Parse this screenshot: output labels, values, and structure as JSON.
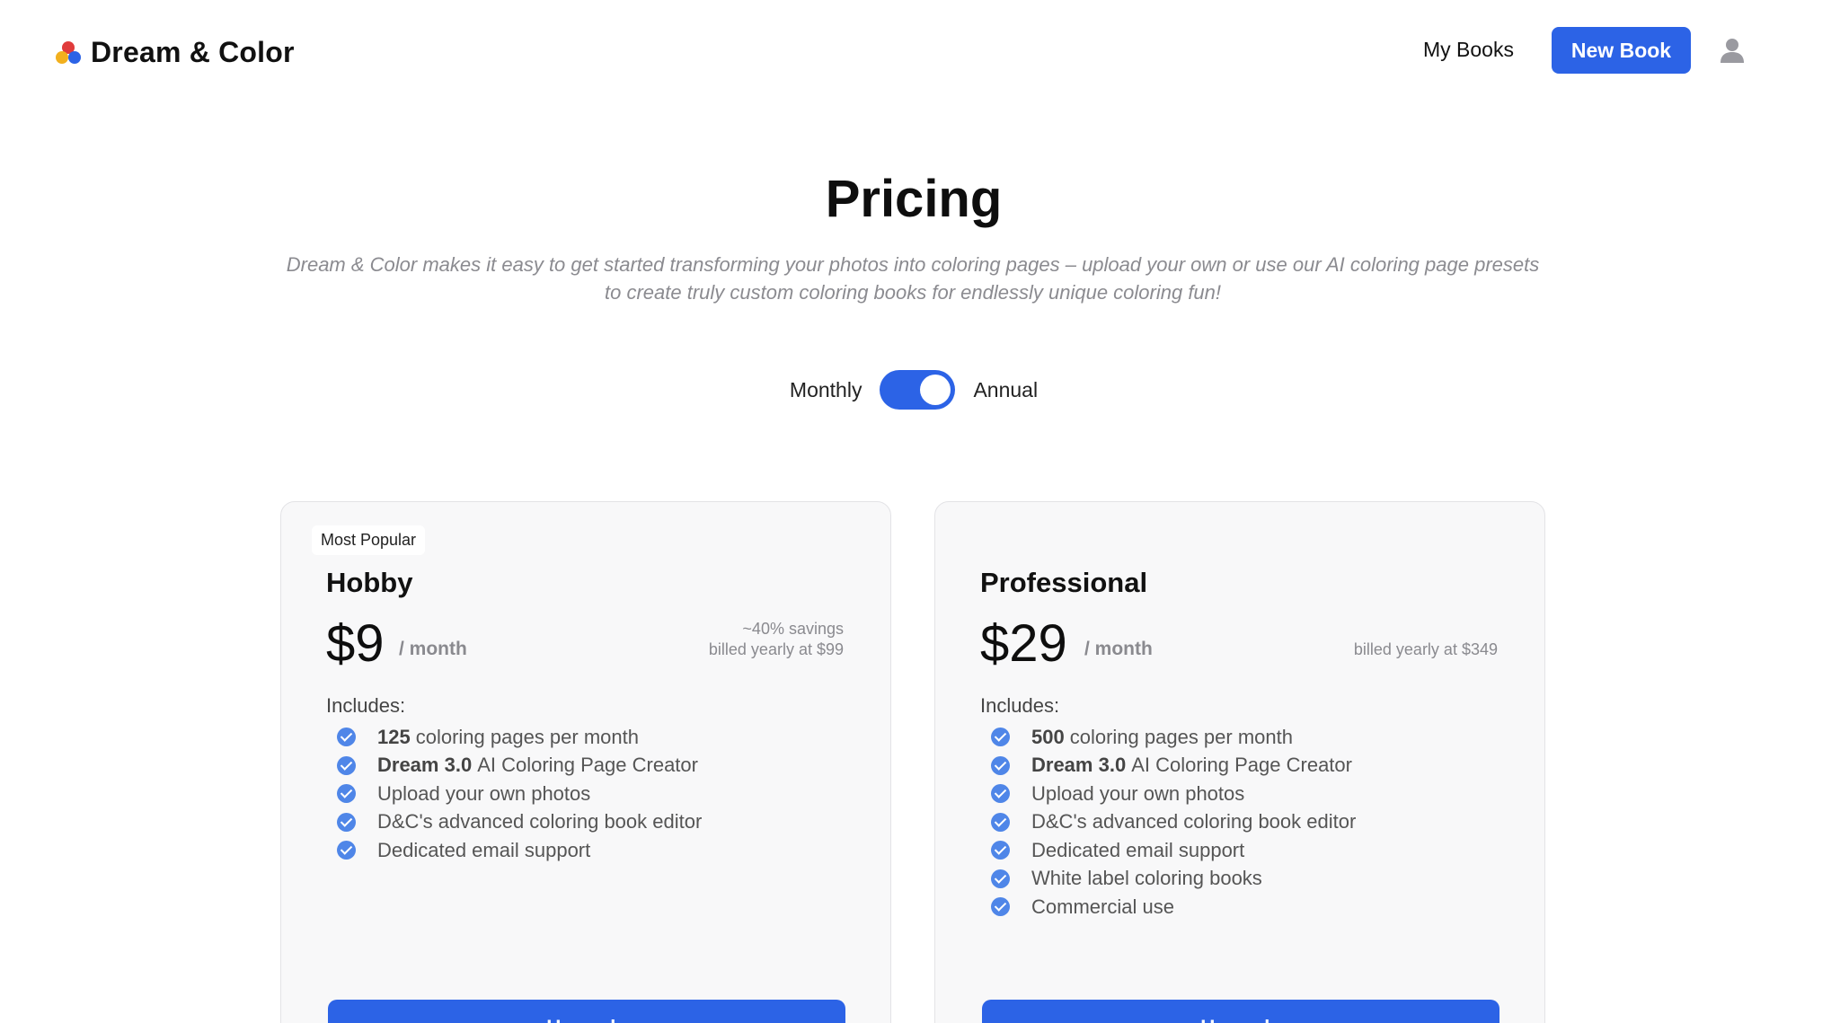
{
  "brand": {
    "name": "Dream & Color",
    "logo_colors": [
      "#e03b3b",
      "#f2b01e",
      "#2c63e6"
    ]
  },
  "nav": {
    "my_books": "My Books",
    "new_book": "New Book",
    "user_icon": "user-icon"
  },
  "page": {
    "title": "Pricing",
    "subtitle": "Dream & Color makes it easy to get started transforming your photos into coloring pages – upload your own or use our AI coloring page presets to create truly custom coloring books for endlessly unique coloring fun!"
  },
  "billing_toggle": {
    "left_label": "Monthly",
    "right_label": "Annual",
    "selected": "Annual"
  },
  "plans": [
    {
      "badge": "Most Popular",
      "name": "Hobby",
      "price": "$9",
      "period": "/ month",
      "savings": "~40% savings",
      "billed": "billed yearly at $99",
      "includes_label": "Includes:",
      "features": [
        {
          "bold": "125",
          "text": "coloring pages per month"
        },
        {
          "bold": "Dream 3.0",
          "text": "AI Coloring Page Creator"
        },
        {
          "bold": "",
          "text": "Upload your own photos"
        },
        {
          "bold": "",
          "text": "D&C's advanced coloring book editor"
        },
        {
          "bold": "",
          "text": "Dedicated email support"
        }
      ],
      "cta": "Upgrade"
    },
    {
      "badge": "",
      "name": "Professional",
      "price": "$29",
      "period": "/ month",
      "savings": "",
      "billed": "billed yearly at $349",
      "includes_label": "Includes:",
      "features": [
        {
          "bold": "500",
          "text": "coloring pages per month"
        },
        {
          "bold": "Dream 3.0",
          "text": "AI Coloring Page Creator"
        },
        {
          "bold": "",
          "text": "Upload your own photos"
        },
        {
          "bold": "",
          "text": "D&C's advanced coloring book editor"
        },
        {
          "bold": "",
          "text": "Dedicated email support"
        },
        {
          "bold": "",
          "text": "White label coloring books"
        },
        {
          "bold": "",
          "text": "Commercial use"
        }
      ],
      "cta": "Upgrade"
    }
  ],
  "colors": {
    "accent": "#2c63e6",
    "check": "#4f86e8",
    "muted_text": "#8a8a8f"
  }
}
